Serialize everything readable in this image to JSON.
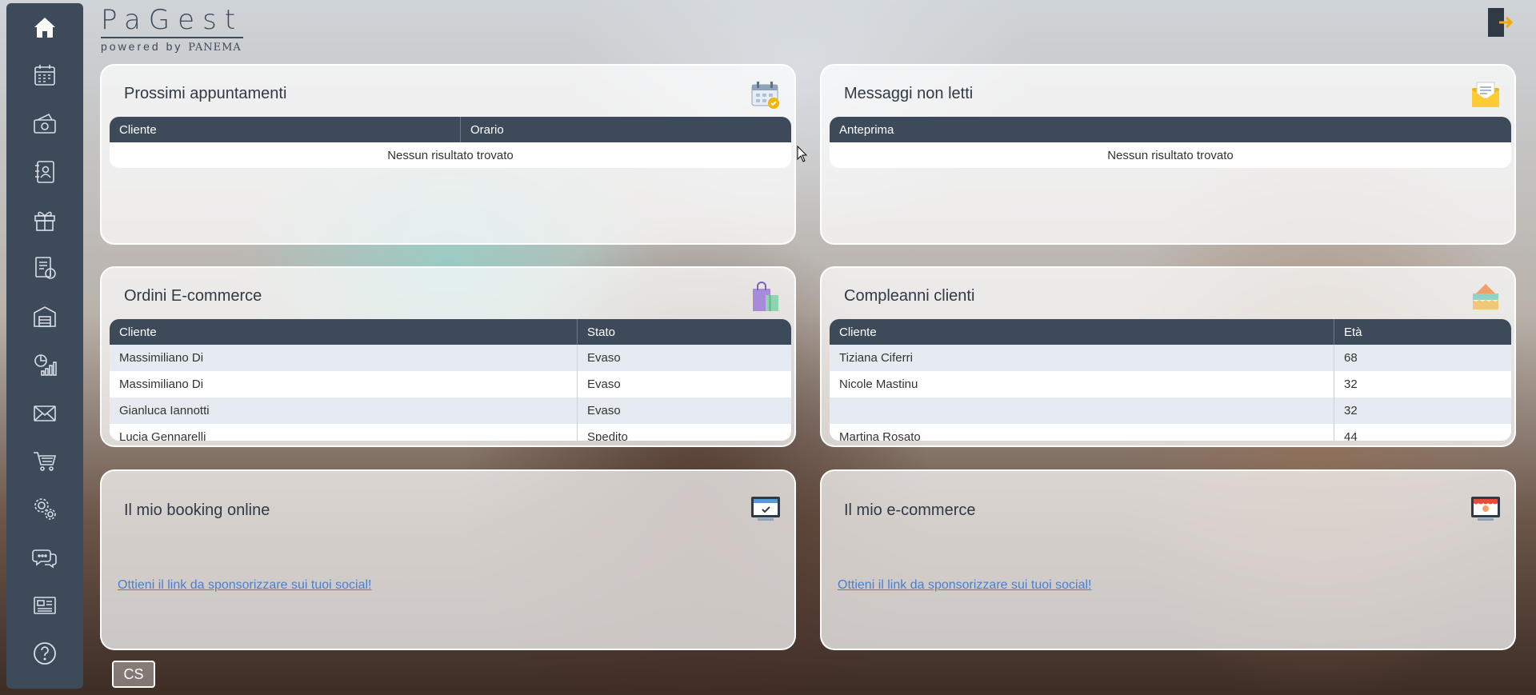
{
  "app": {
    "brand": "PaGest",
    "powered_by": "powered by",
    "powered_brand": "PANEMA"
  },
  "sidebar": {
    "items": [
      {
        "name": "home",
        "icon": "home-icon"
      },
      {
        "name": "calendar",
        "icon": "calendar-icon"
      },
      {
        "name": "cash",
        "icon": "cash-icon"
      },
      {
        "name": "contacts",
        "icon": "address-book-icon"
      },
      {
        "name": "gifts",
        "icon": "gift-icon"
      },
      {
        "name": "invoices",
        "icon": "invoice-icon"
      },
      {
        "name": "warehouse",
        "icon": "warehouse-icon"
      },
      {
        "name": "stats",
        "icon": "stats-icon"
      },
      {
        "name": "messages",
        "icon": "mail-icon"
      },
      {
        "name": "ecommerce",
        "icon": "cart-icon"
      },
      {
        "name": "settings",
        "icon": "gears-icon"
      },
      {
        "name": "chat",
        "icon": "chat-icon"
      },
      {
        "name": "news",
        "icon": "news-icon"
      },
      {
        "name": "help",
        "icon": "help-icon"
      }
    ]
  },
  "cards": {
    "appointments": {
      "title": "Prossimi appuntamenti",
      "columns": [
        "Cliente",
        "Orario"
      ],
      "empty": "Nessun risultato trovato"
    },
    "messages": {
      "title": "Messaggi non letti",
      "columns": [
        "Anteprima"
      ],
      "empty": "Nessun risultato trovato"
    },
    "orders": {
      "title": "Ordini E-commerce",
      "columns": [
        "Cliente",
        "Stato"
      ],
      "rows": [
        [
          "Massimiliano Di",
          "Evaso"
        ],
        [
          "Massimiliano Di",
          "Evaso"
        ],
        [
          "Gianluca Iannotti",
          "Evaso"
        ],
        [
          "Lucia Gennarelli",
          "Spedito"
        ]
      ]
    },
    "birthdays": {
      "title": "Compleanni clienti",
      "columns": [
        "Cliente",
        "Età"
      ],
      "rows": [
        [
          "Tiziana Ciferri",
          "68"
        ],
        [
          "Nicole Mastinu",
          "32"
        ],
        [
          "",
          "32"
        ],
        [
          "Martina Rosato",
          "44"
        ]
      ]
    },
    "booking": {
      "title": "Il mio booking online",
      "link": "Ottieni il link da sponsorizzare sui tuoi social!"
    },
    "ecommerce": {
      "title": "Il mio e-commerce",
      "link": "Ottieni il link da sponsorizzare sui tuoi social!"
    }
  },
  "footer": {
    "user_initials": "CS"
  },
  "colors": {
    "sidebar": "#3d4a5a",
    "table_header": "#3d4a5a",
    "link": "#4a7fd0"
  }
}
